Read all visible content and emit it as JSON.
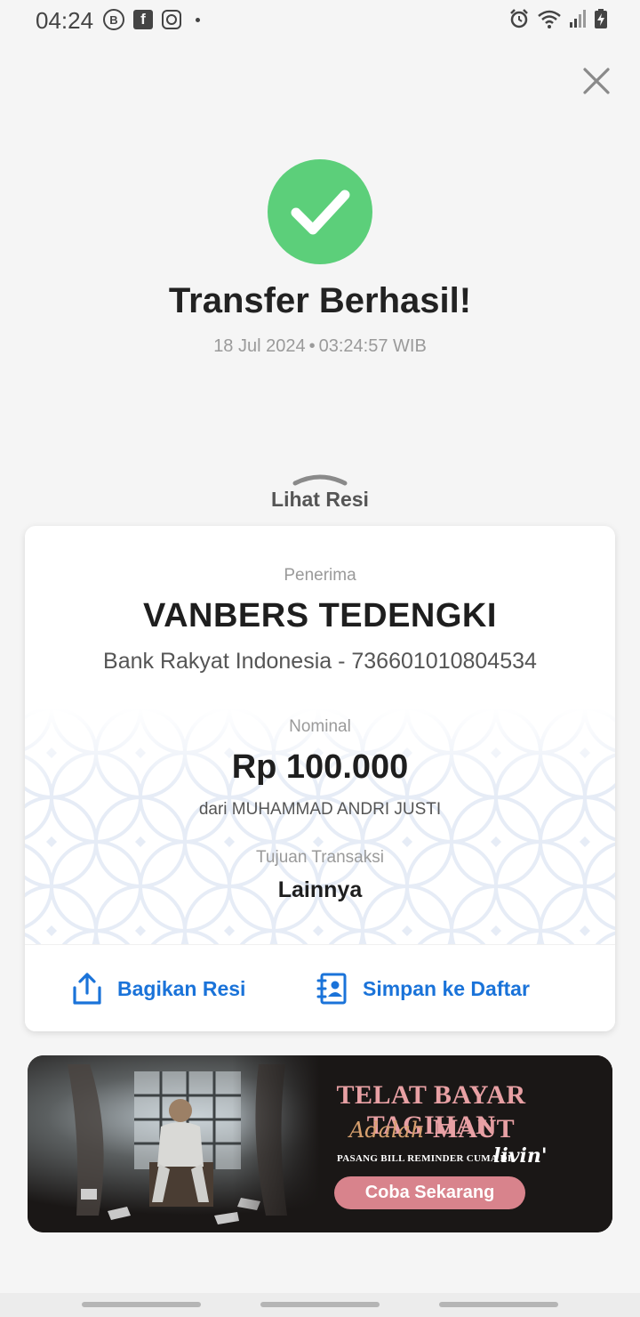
{
  "status_bar": {
    "time": "04:24",
    "left_icons": [
      "b-circle-icon",
      "facebook-icon",
      "instagram-icon",
      "dot-icon"
    ],
    "right_icons": [
      "alarm-icon",
      "wifi-icon",
      "signal-icon",
      "battery-charging-icon"
    ]
  },
  "result": {
    "title": "Transfer Berhasil!",
    "date": "18 Jul 2024",
    "separator": "•",
    "time": "03:24:57 WIB",
    "status_color": "#5ccf7a"
  },
  "receipt_toggle": {
    "label": "Lihat Resi"
  },
  "receipt": {
    "recipient_label": "Penerima",
    "recipient_name": "VANBERS TEDENGKI",
    "recipient_bank": "Bank Rakyat Indonesia - 736601010804534",
    "amount_label": "Nominal",
    "amount": "Rp 100.000",
    "from": "dari MUHAMMAD ANDRI JUSTI",
    "purpose_label": "Tujuan Transaksi",
    "purpose": "Lainnya"
  },
  "actions": {
    "share": "Bagikan Resi",
    "save": "Simpan ke Daftar",
    "accent_color": "#1a73d9"
  },
  "banner": {
    "headline_1": "TELAT BAYAR TAGIHAN",
    "headline_script": "Adalah",
    "headline_2": "MAUT",
    "subtext": "PASANG BILL REMINDER CUMA DI",
    "logo": "livin'",
    "cta": "Coba Sekarang"
  }
}
